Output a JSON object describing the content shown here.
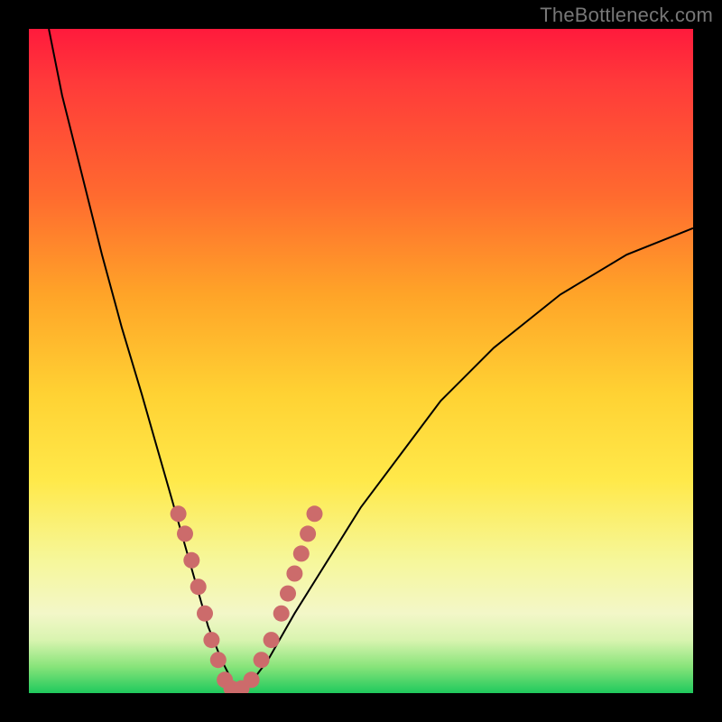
{
  "watermark": "TheBottleneck.com",
  "chart_data": {
    "type": "line",
    "title": "",
    "xlabel": "",
    "ylabel": "",
    "xlim": [
      0,
      100
    ],
    "ylim": [
      0,
      100
    ],
    "series": [
      {
        "name": "bottleneck-curve",
        "x": [
          3,
          5,
          8,
          11,
          14,
          17,
          19,
          21,
          23,
          25,
          27,
          29,
          31,
          33,
          36,
          40,
          45,
          50,
          56,
          62,
          70,
          80,
          90,
          100
        ],
        "values": [
          100,
          90,
          78,
          66,
          55,
          45,
          38,
          31,
          24,
          17,
          10,
          5,
          1,
          1,
          5,
          12,
          20,
          28,
          36,
          44,
          52,
          60,
          66,
          70
        ]
      }
    ],
    "markers": {
      "name": "highlight-points",
      "x": [
        22.5,
        23.5,
        24.5,
        25.5,
        26.5,
        27.5,
        28.5,
        29.5,
        30.5,
        32,
        33.5,
        35,
        36.5,
        38,
        39,
        40,
        41,
        42,
        43
      ],
      "values": [
        27,
        24,
        20,
        16,
        12,
        8,
        5,
        2,
        0.7,
        0.7,
        2,
        5,
        8,
        12,
        15,
        18,
        21,
        24,
        27
      ],
      "color": "#cc6b6b"
    },
    "background_gradient": {
      "stops": [
        {
          "pos": 0,
          "color": "#ff1a3c"
        },
        {
          "pos": 25,
          "color": "#ff6a2f"
        },
        {
          "pos": 55,
          "color": "#ffd233"
        },
        {
          "pos": 88,
          "color": "#f3f7c8"
        },
        {
          "pos": 100,
          "color": "#1fc95d"
        }
      ]
    }
  }
}
